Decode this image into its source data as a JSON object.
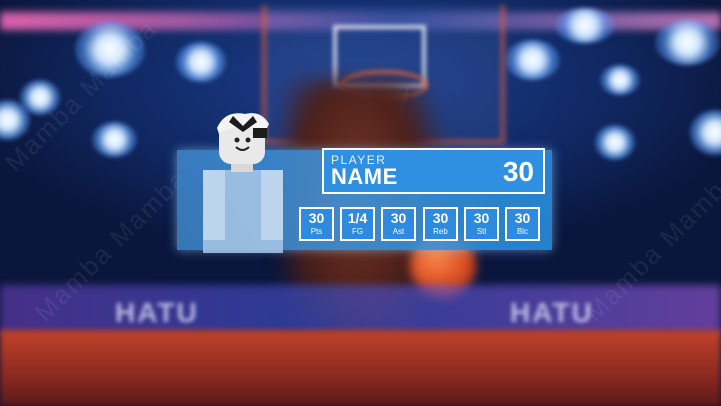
{
  "background": {
    "ad_board_texts": [
      "HATU",
      "HATU"
    ],
    "watermark_text": "Mamba Mamba"
  },
  "card": {
    "label": "PLAYER",
    "name": "NAME",
    "number": "30",
    "stats": [
      {
        "value": "30",
        "label": "Pts"
      },
      {
        "value": "1/4",
        "label": "FG"
      },
      {
        "value": "30",
        "label": "Ast"
      },
      {
        "value": "30",
        "label": "Reb"
      },
      {
        "value": "30",
        "label": "Stl"
      },
      {
        "value": "30",
        "label": "Blc"
      }
    ]
  },
  "colors": {
    "card_blue": "#2f8fe0",
    "border": "#ffffff",
    "floor": "#c2422a"
  },
  "icons": {
    "avatar": "roblox-avatar-icon"
  }
}
